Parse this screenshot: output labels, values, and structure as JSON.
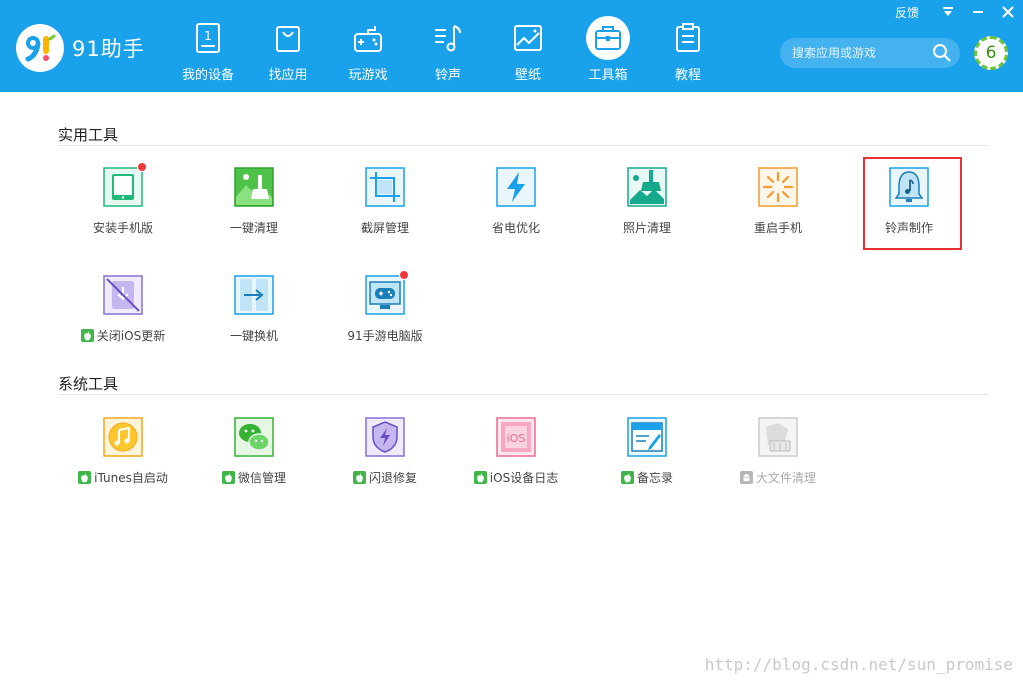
{
  "app": {
    "name": "91助手"
  },
  "topbar": {
    "feedback": "反馈"
  },
  "nav": [
    {
      "label": "我的设备",
      "icon": "device-icon"
    },
    {
      "label": "找应用",
      "icon": "bag-icon"
    },
    {
      "label": "玩游戏",
      "icon": "gamepad-icon"
    },
    {
      "label": "铃声",
      "icon": "music-note-icon"
    },
    {
      "label": "壁纸",
      "icon": "wallpaper-icon"
    },
    {
      "label": "工具箱",
      "icon": "toolbox-icon",
      "active": true
    },
    {
      "label": "教程",
      "icon": "clipboard-icon"
    }
  ],
  "search": {
    "placeholder": "搜索应用或游戏"
  },
  "user": {
    "level": "6"
  },
  "sections": {
    "practical": {
      "title": "实用工具",
      "tools": [
        {
          "label": "安装手机版",
          "icon": "tablet-icon",
          "dot": true
        },
        {
          "label": "一键清理",
          "icon": "broom-image-icon"
        },
        {
          "label": "截屏管理",
          "icon": "crop-icon"
        },
        {
          "label": "省电优化",
          "icon": "lightning-icon"
        },
        {
          "label": "照片清理",
          "icon": "photo-clean-icon"
        },
        {
          "label": "重启手机",
          "icon": "restart-burst-icon"
        },
        {
          "label": "铃声制作",
          "icon": "bell-icon",
          "highlighted": true
        },
        {
          "label": "关闭iOS更新",
          "icon": "disable-update-icon",
          "os": "ios"
        },
        {
          "label": "一键换机",
          "icon": "phone-transfer-icon"
        },
        {
          "label": "91手游电脑版",
          "icon": "gamepad-monitor-icon",
          "dot": true
        }
      ]
    },
    "system": {
      "title": "系统工具",
      "tools": [
        {
          "label": "iTunes自启动",
          "icon": "itunes-icon",
          "os": "ios"
        },
        {
          "label": "微信管理",
          "icon": "wechat-icon",
          "os": "ios"
        },
        {
          "label": "闪退修复",
          "icon": "shield-bolt-icon",
          "os": "ios"
        },
        {
          "label": "iOS设备日志",
          "icon": "ios-log-icon",
          "os": "ios"
        },
        {
          "label": "备忘录",
          "icon": "memo-icon",
          "os": "ios"
        },
        {
          "label": "大文件清理",
          "icon": "file-clean-icon",
          "os": "android",
          "disabled": true
        }
      ]
    }
  },
  "watermark": "http://blog.csdn.net/sun_promise",
  "colors": {
    "header": "#1aa1ec",
    "highlight": "#e8302f",
    "dot": "#ef3a3a",
    "ios_badge": "#3fb54a"
  }
}
